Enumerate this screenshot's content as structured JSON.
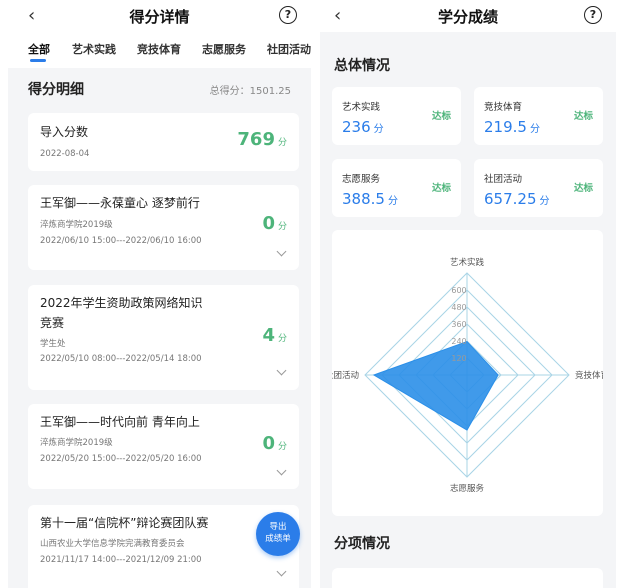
{
  "left": {
    "title": "得分详情",
    "tabs": [
      "全部",
      "艺术实践",
      "竞技体育",
      "志愿服务",
      "社团活动"
    ],
    "section_title": "得分明细",
    "total_label": "总得分：1501.25",
    "cards": [
      {
        "title": "导入分数",
        "date": "2022-08-04",
        "score": "769",
        "unit": "分"
      },
      {
        "title": "王军御——永葆童心 逐梦前行",
        "sub": "淬炼商学院2019级",
        "date": "2022/06/10 15:00---2022/06/10 16:00",
        "score": "0",
        "unit": "分"
      },
      {
        "title_line1": "2022年学生资助政策网络知识",
        "title_line2": "竞赛",
        "sub": "学生处",
        "date": "2022/05/10 08:00---2022/05/14 18:00",
        "score": "4",
        "unit": "分"
      },
      {
        "title": "王军御——时代向前 青年向上",
        "sub": "淬炼商学院2019级",
        "date": "2022/05/20 15:00---2022/05/20 16:00",
        "score": "0",
        "unit": "分"
      },
      {
        "title": "第十一届“信院杯”辩论赛团队赛",
        "sub": "山西农业大学信息学院完满教育委员会",
        "date": "2021/11/17 14:00---2021/12/09 21:00"
      }
    ],
    "export_line1": "导出",
    "export_line2": "成绩单"
  },
  "right": {
    "title": "学分成绩",
    "overview_title": "总体情况",
    "stats": [
      {
        "name": "艺术实践",
        "value": "236",
        "unit": "分",
        "badge": "达标"
      },
      {
        "name": "竞技体育",
        "value": "219.5",
        "unit": "分",
        "badge": "达标"
      },
      {
        "name": "志愿服务",
        "value": "388.5",
        "unit": "分",
        "badge": "达标"
      },
      {
        "name": "社团活动",
        "value": "657.25",
        "unit": "分",
        "badge": "达标"
      }
    ],
    "detail_title": "分项情况"
  },
  "chart_data": {
    "type": "radar",
    "axes": [
      "艺术实践",
      "竞技体育",
      "志愿服务",
      "社团活动"
    ],
    "values": [
      236,
      219.5,
      388.5,
      657.25
    ],
    "ticks": [
      "120",
      "240",
      "360",
      "480",
      "600"
    ],
    "max": 720,
    "colors": {
      "fill": "#2b8fe8",
      "grid": "#a9d4e6"
    }
  },
  "colors": {
    "accent": "#2b7de9",
    "score_green": "#4db47a"
  }
}
